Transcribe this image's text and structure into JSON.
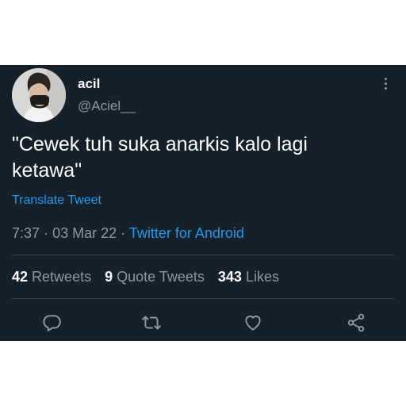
{
  "user": {
    "name": "acil",
    "handle": "@Aciel__"
  },
  "tweet": {
    "text_line1": "\"Cewek tuh suka anarkis kalo lagi",
    "text_line2": "ketawa\"",
    "translate_label": "Translate Tweet",
    "time": "7:37",
    "date": "03 Mar 22",
    "separator": "·",
    "source": "Twitter for Android"
  },
  "stats": {
    "retweets_count": "42",
    "retweets_label": "Retweets",
    "quotes_count": "9",
    "quotes_label": "Quote Tweets",
    "likes_count": "343",
    "likes_label": "Likes"
  },
  "actions": [
    "reply-icon",
    "retweet-icon",
    "like-icon",
    "share-icon"
  ],
  "colors": {
    "background": "#15202b",
    "accent": "#1d9bf0",
    "muted": "#8b98a5",
    "divider": "#38444d"
  }
}
